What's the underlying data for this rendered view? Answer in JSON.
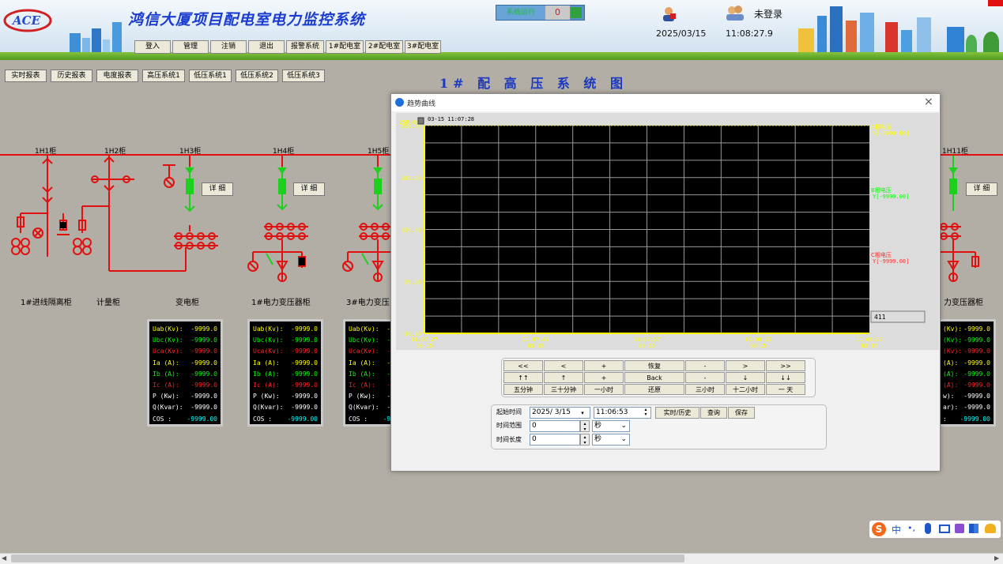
{
  "header": {
    "title": "鸿信大厦项目配电室电力监控系统",
    "logo_text": "ACE",
    "alarm_label": "系统运行",
    "alarm_count": "0",
    "date": "2025/03/15",
    "time": "11:08:27.9",
    "login_status": "未登录"
  },
  "menu": [
    "登入",
    "管理",
    "注销",
    "退出",
    "报警系统",
    "1#配电室",
    "2#配电室",
    "3#配电室"
  ],
  "toolbar": [
    "实时报表",
    "历史报表",
    "电度报表",
    "高压系统1",
    "低压系统1",
    "低压系统2",
    "低压系统3"
  ],
  "diagram": {
    "title": "1# 配 高 压 系 统 图",
    "cabinet_ids": [
      "1H1柜",
      "1H2柜",
      "1H3柜",
      "1H4柜",
      "1H5柜",
      "1H11柜"
    ],
    "captions": [
      "1#进线隔离柜",
      "计量柜",
      "变电柜",
      "1#电力变压器柜",
      "3#电力变压",
      "力变压器柜"
    ],
    "detail_label": "详 细"
  },
  "panels": {
    "keys": [
      "Uab(Kv):",
      "Ubc(Kv):",
      "Uca(Kv):",
      "Ia (A):",
      "Ib (A):",
      "Ic (A):",
      "P (Kw):",
      "Q(Kvar):",
      "COS  :"
    ],
    "right_keys": [
      "(Kv):",
      "(Kv):",
      "(Kv):",
      "(A):",
      "(A):",
      "(A):",
      "w):",
      "ar):",
      ":"
    ],
    "value": "-9999.0",
    "cos_value": "-9999.00",
    "colors": [
      "#ffff00",
      "#00ff00",
      "#ff2020",
      "#ffff00",
      "#00ff00",
      "#ff2020",
      "#ffffff",
      "#ffffff",
      "#ffffff"
    ],
    "cos_color": "#00ffff"
  },
  "dialog": {
    "title": "趋势曲线",
    "close": "×",
    "nav_rows": [
      [
        "<<",
        "<",
        "+",
        "恢复",
        "-",
        ">",
        ">>"
      ],
      [
        "↑↑",
        "↑",
        "+",
        "Back",
        "-",
        "↓",
        "↓↓"
      ],
      [
        "五分钟",
        "三十分钟",
        "一小时",
        "还原",
        "三小时",
        "十二小时",
        "一 天"
      ]
    ],
    "query": {
      "start_label": "起始时间",
      "range_label": "时间范围",
      "length_label": "时间长度",
      "start_date": "2025/ 3/15",
      "start_time": "11:06:53",
      "range_value": "0",
      "length_value": "0",
      "unit": "秒",
      "btn_realtime": "实时/历史",
      "btn_query": "查询",
      "btn_save": "保存"
    }
  },
  "chart_data": {
    "type": "line",
    "title": "",
    "timestamp_label": "03-15 11:07:28",
    "y_ticks": [
      "250.00",
      "185.00",
      "120.00",
      "55.00",
      "-10.00"
    ],
    "y_top_extra": "250.00",
    "ylim": [
      -10,
      250
    ],
    "x_ticks": [
      {
        "time": "11:07:27",
        "date": "03-15"
      },
      {
        "time": "11:07:42",
        "date": "03-15"
      },
      {
        "time": "11:07:57",
        "date": "03-15"
      },
      {
        "time": "11:08:12",
        "date": "03-15"
      },
      {
        "time": "11:08:27",
        "date": "03-15"
      }
    ],
    "series": [
      {
        "name": "A相电压",
        "value_label": "Y[-9999.00]",
        "color": "#ffff00"
      },
      {
        "name": "B相电压",
        "value_label": "Y[-9999.00]",
        "color": "#00ff00"
      },
      {
        "name": "C相电压",
        "value_label": "Y[-9999.00]",
        "color": "#ff3030"
      }
    ],
    "side_box_value": "411",
    "background": "#000000",
    "grid": true
  }
}
